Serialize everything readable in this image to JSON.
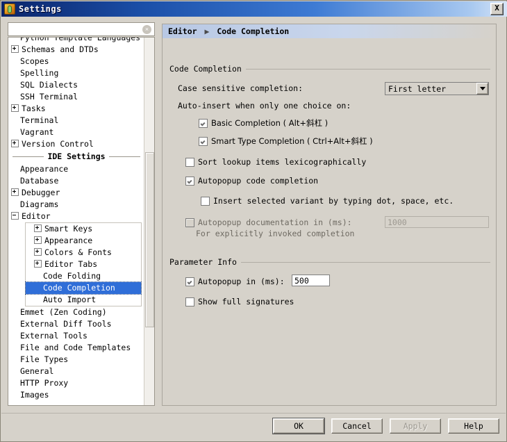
{
  "window": {
    "title": "Settings",
    "close_label": "X",
    "app_icon": "pycharm-icon"
  },
  "search": {
    "value": "",
    "placeholder": "",
    "clear_label": "×"
  },
  "tree": {
    "items": [
      {
        "label": "Python Template Languages",
        "indent": 0,
        "toggle": "none",
        "clipped": true
      },
      {
        "label": "Schemas and DTDs",
        "indent": 0,
        "toggle": "plus"
      },
      {
        "label": "Scopes",
        "indent": 0,
        "toggle": "none"
      },
      {
        "label": "Spelling",
        "indent": 0,
        "toggle": "none"
      },
      {
        "label": "SQL Dialects",
        "indent": 0,
        "toggle": "none"
      },
      {
        "label": "SSH Terminal",
        "indent": 0,
        "toggle": "none"
      },
      {
        "label": "Tasks",
        "indent": 0,
        "toggle": "plus"
      },
      {
        "label": "Terminal",
        "indent": 0,
        "toggle": "none"
      },
      {
        "label": "Vagrant",
        "indent": 0,
        "toggle": "none"
      },
      {
        "label": "Version Control",
        "indent": 0,
        "toggle": "plus"
      }
    ],
    "separator_label": "IDE Settings",
    "items2": [
      {
        "label": "Appearance",
        "indent": 0,
        "toggle": "none"
      },
      {
        "label": "Database",
        "indent": 0,
        "toggle": "none"
      },
      {
        "label": "Debugger",
        "indent": 0,
        "toggle": "plus"
      },
      {
        "label": "Diagrams",
        "indent": 0,
        "toggle": "none"
      },
      {
        "label": "Editor",
        "indent": 0,
        "toggle": "minus"
      }
    ],
    "editor_children": [
      {
        "label": "Smart Keys",
        "toggle": "plus",
        "selected": false
      },
      {
        "label": "Appearance",
        "toggle": "plus",
        "selected": false
      },
      {
        "label": "Colors & Fonts",
        "toggle": "plus",
        "selected": false
      },
      {
        "label": "Editor Tabs",
        "toggle": "plus",
        "selected": false
      },
      {
        "label": "Code Folding",
        "toggle": "none",
        "selected": false
      },
      {
        "label": "Code Completion",
        "toggle": "none",
        "selected": true
      },
      {
        "label": "Auto Import",
        "toggle": "none",
        "selected": false
      }
    ],
    "items3": [
      {
        "label": "Emmet (Zen Coding)",
        "indent": 0,
        "toggle": "none"
      },
      {
        "label": "External Diff Tools",
        "indent": 0,
        "toggle": "none"
      },
      {
        "label": "External Tools",
        "indent": 0,
        "toggle": "none"
      },
      {
        "label": "File and Code Templates",
        "indent": 0,
        "toggle": "none"
      },
      {
        "label": "File Types",
        "indent": 0,
        "toggle": "none"
      },
      {
        "label": "General",
        "indent": 0,
        "toggle": "none"
      },
      {
        "label": "HTTP Proxy",
        "indent": 0,
        "toggle": "none"
      },
      {
        "label": "Images",
        "indent": 0,
        "toggle": "none"
      }
    ],
    "selected_color": "#2f6ed8"
  },
  "breadcrumb": {
    "parent": "Editor",
    "arrow": "▶",
    "current": "Code Completion"
  },
  "code_completion": {
    "group_title": "Code Completion",
    "case_sensitive_label": "Case sensitive completion:",
    "case_sensitive_value": "First letter",
    "auto_insert_label": "Auto-insert when only one choice on:",
    "basic_completion_label": "Basic Completion ( Alt+斜杠 )",
    "basic_completion_checked": true,
    "smart_type_label": "Smart Type Completion ( Ctrl+Alt+斜杠 )",
    "smart_type_checked": true,
    "sort_lookup_label": "Sort lookup items lexicographically",
    "sort_lookup_checked": false,
    "autopopup_code_label": "Autopopup code completion",
    "autopopup_code_checked": true,
    "insert_variant_label": "Insert selected variant by typing dot, space, etc.",
    "insert_variant_checked": false,
    "autopopup_doc_label": "Autopopup documentation in (ms):",
    "autopopup_doc_checked": false,
    "autopopup_doc_value": "1000",
    "autopopup_doc_hint": "For explicitly invoked completion"
  },
  "parameter_info": {
    "group_title": "Parameter Info",
    "autopopup_label": "Autopopup in (ms):",
    "autopopup_checked": true,
    "autopopup_value": "500",
    "show_signatures_label": "Show full signatures",
    "show_signatures_checked": false
  },
  "footer": {
    "ok": "OK",
    "cancel": "Cancel",
    "apply": "Apply",
    "apply_disabled": true,
    "help": "Help"
  }
}
